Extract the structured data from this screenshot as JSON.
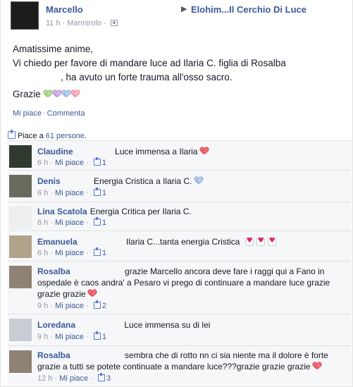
{
  "post": {
    "author": "Marcello",
    "arrow": "▶",
    "group": "Elohim...Il Cerchio Di Luce",
    "time": "11 h",
    "location": "Marmirolo",
    "line1": "Amatissime anime,",
    "line2": "Vi chiedo per favore di mandare luce ad Ilaria C. figlia di Rosalba",
    "line3": ", ha avuto un forte trauma all'osso sacro.",
    "line4": "Grazie",
    "like": "Mi piace",
    "comment": "Commenta",
    "likes_prefix": "Piace a",
    "likes_link": "61 persone",
    "likes_suffix": "."
  },
  "comments": [
    {
      "name": "Claudine",
      "text": "Luce immensa a Ilaria",
      "time": "6 h",
      "like": "Mi piace",
      "count": "1"
    },
    {
      "name": "Denis",
      "text": "Energia Cristica a Ilaria C.",
      "time": "6 h",
      "like": "Mi piace",
      "count": "1"
    },
    {
      "name": "Lina Scatola",
      "text": "Energia Critica per Ilaria C.",
      "time": "6 h",
      "like": "Mi piace",
      "count": "1"
    },
    {
      "name": "Emanuela",
      "text": "Ilaria C...tanta energia Cristica",
      "time": "6 h",
      "like": "Mi piace",
      "count": "1"
    },
    {
      "name": "Rosalba",
      "text1": "grazie Marcello ancora deve fare i raggi qui a Fano in",
      "text2": "ospedale è caos andra' a Pesaro vi prego di continuare a mandare luce grazie",
      "text3": "grazie grazie",
      "time": "9 h",
      "like": "Mi piace",
      "count": "2"
    },
    {
      "name": "Loredana",
      "text": "Luce immensa su di lei",
      "time": "9 h",
      "like": "Mi piace",
      "count": "1"
    },
    {
      "name": "Rosalba",
      "text1": "sembra che di rotto nn ci sia niente ma il dolore è forte",
      "text2": "grazie a tutti se potete continuate a mandare luce???grazie grazie grazie",
      "time": "12 h",
      "like": "Mi piace",
      "count": "3"
    }
  ]
}
